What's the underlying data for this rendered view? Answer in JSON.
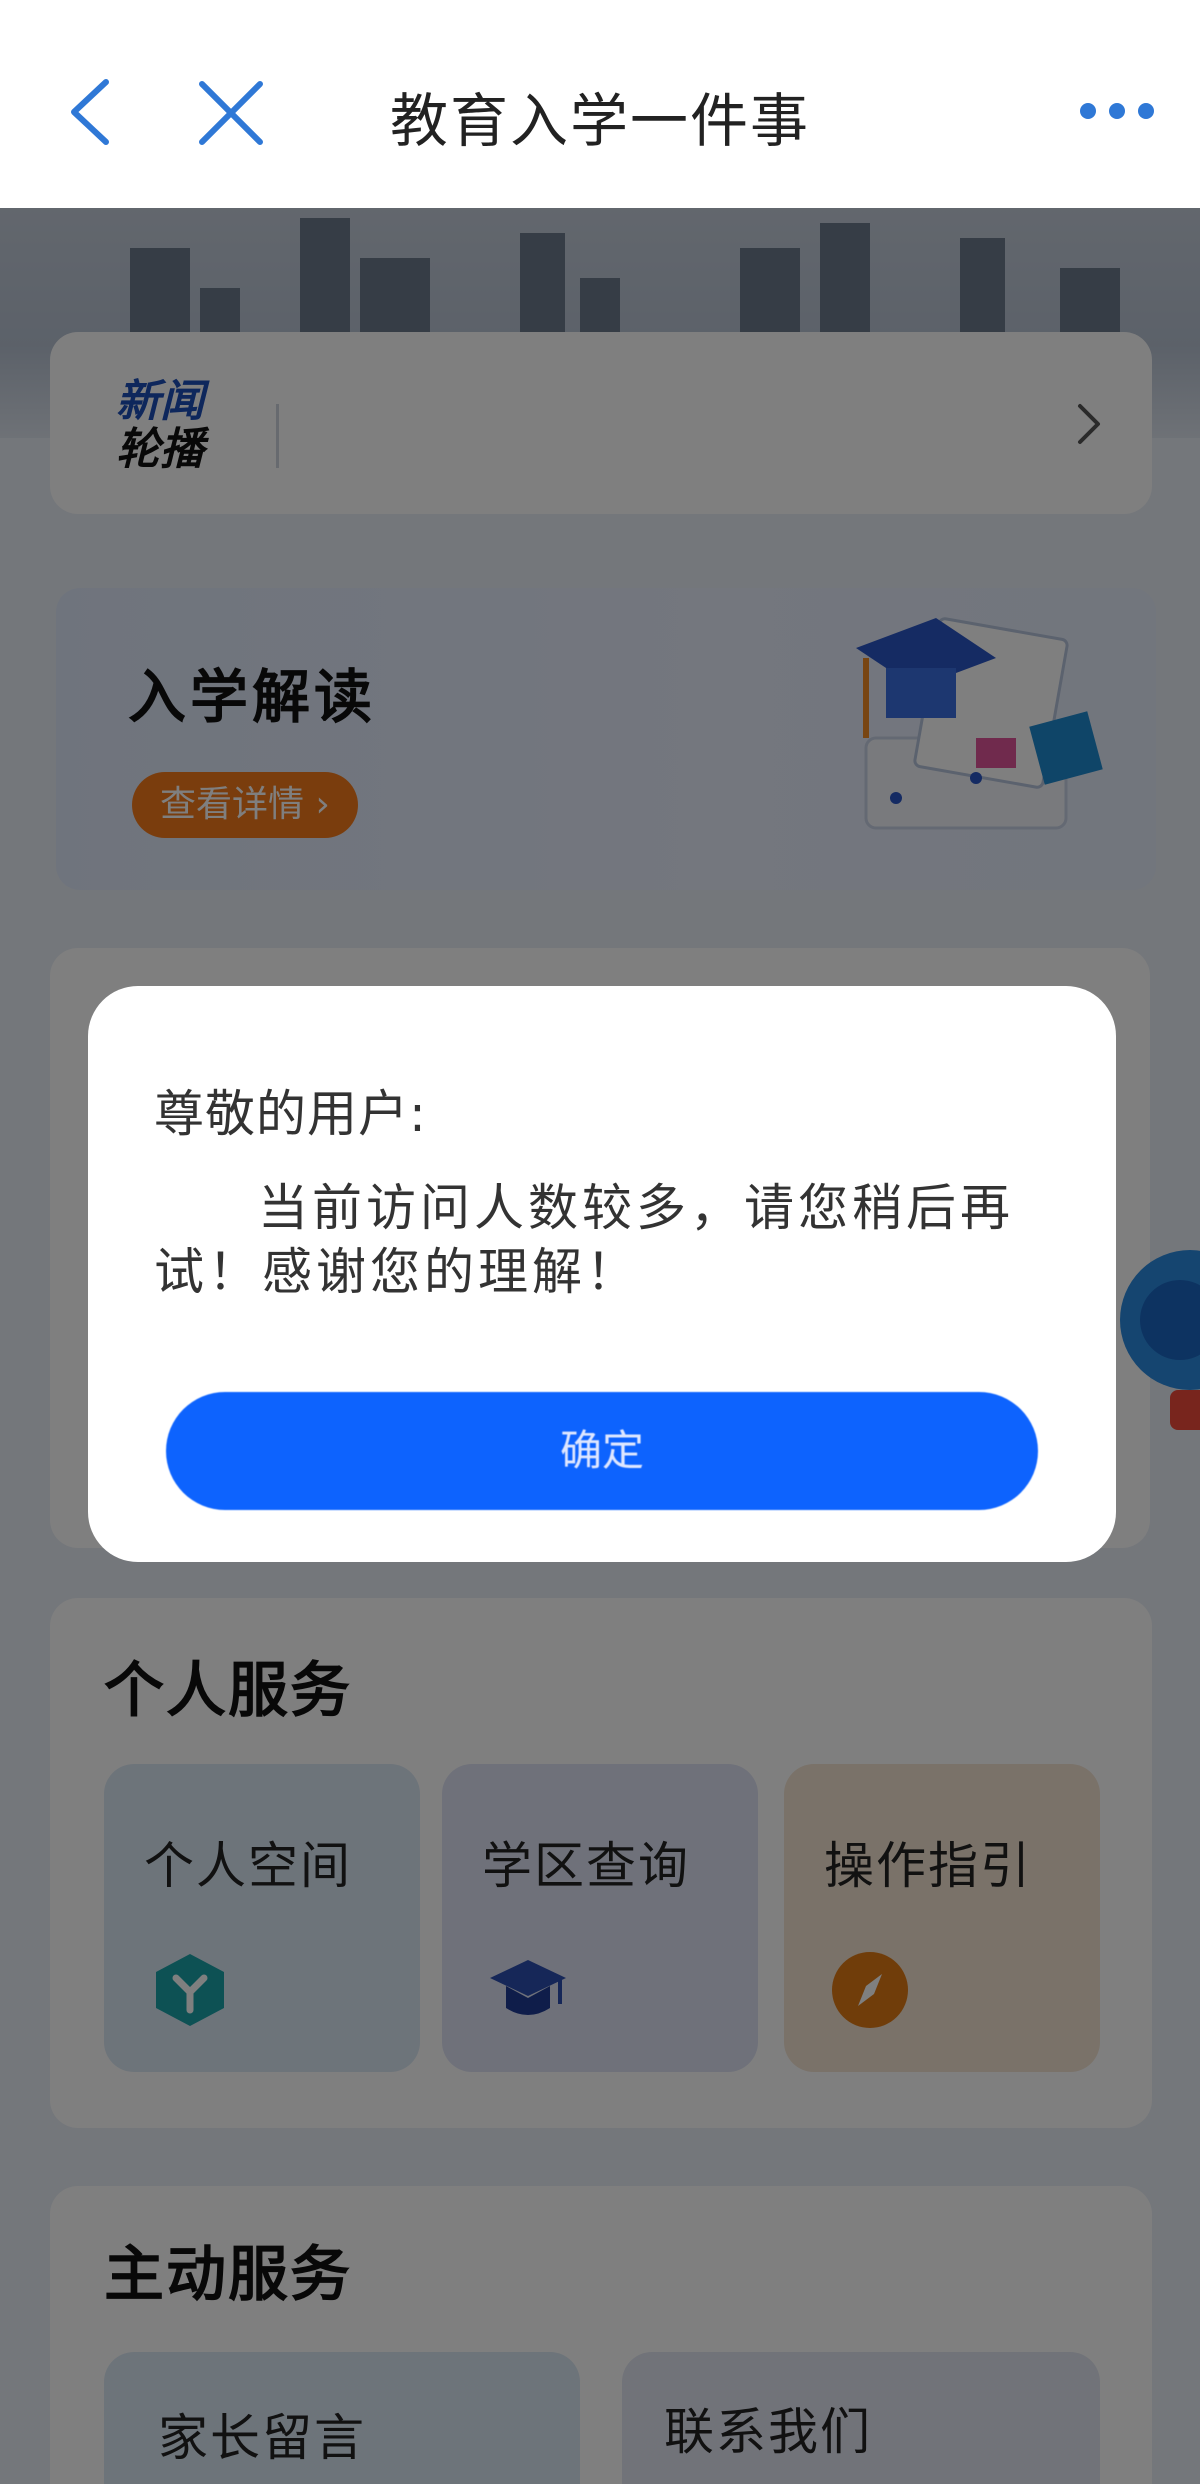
{
  "navbar": {
    "title": "教育入学一件事",
    "back_icon": "chevron-left-icon",
    "close_icon": "close-icon",
    "more_icon": "more-dots-icon",
    "accent_color": "#2f78d6"
  },
  "news": {
    "logo_line1": "新闻",
    "logo_line2": "轮播"
  },
  "banner": {
    "title": "入学解读",
    "button_label": "查看详情 ›",
    "button_color": "#f47b1a"
  },
  "personal_services": {
    "title": "个人服务",
    "items": [
      {
        "label": "个人空间",
        "icon": "cube-y-icon"
      },
      {
        "label": "学区查询",
        "icon": "graduation-cap-icon"
      },
      {
        "label": "操作指引",
        "icon": "compass-icon"
      }
    ]
  },
  "active_services": {
    "title": "主动服务",
    "items": [
      {
        "label": "家长留言"
      },
      {
        "label": "联系我们"
      }
    ]
  },
  "dialog": {
    "greeting": "尊敬的用户:",
    "message": "当前访问人数较多，请您稍后再试！感谢您的理解！",
    "button_label": "确定",
    "button_color": "#0d63fe"
  }
}
